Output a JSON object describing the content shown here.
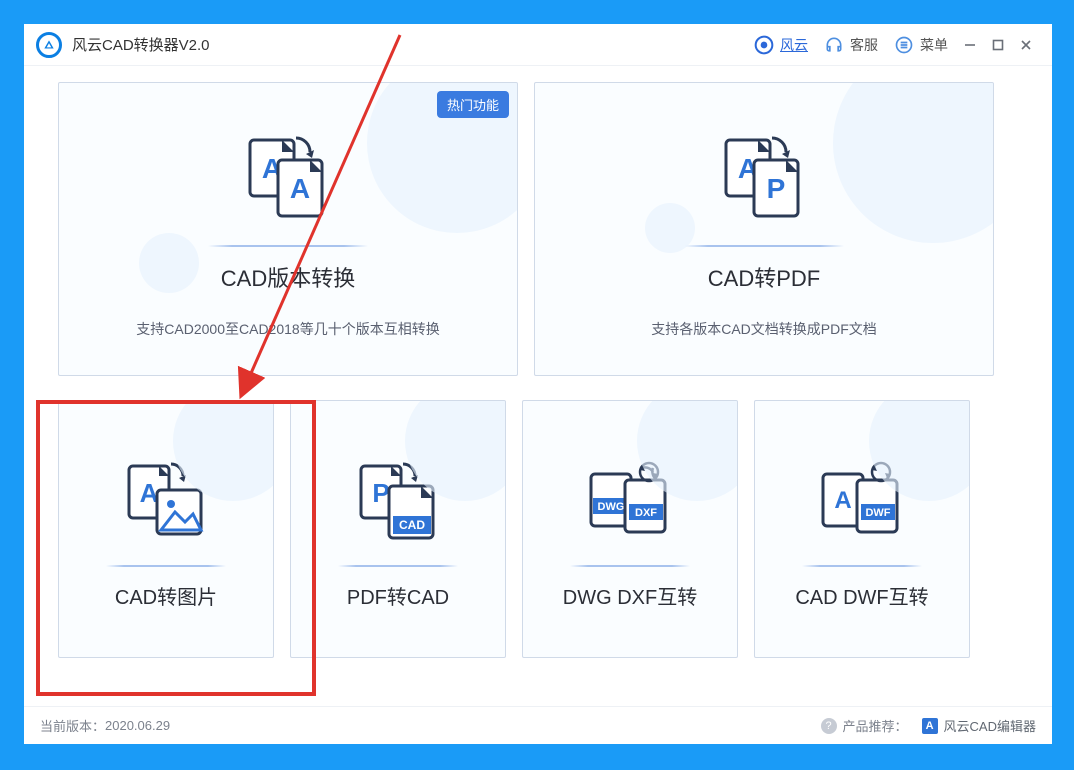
{
  "titlebar": {
    "title": "风云CAD转换器V2.0",
    "brand": "风云",
    "support": "客服",
    "menu": "菜单"
  },
  "cards": {
    "version": {
      "title": "CAD版本转换",
      "sub": "支持CAD2000至CAD2018等几十个版本互相转换",
      "badge": "热门功能"
    },
    "pdf": {
      "title": "CAD转PDF",
      "sub": "支持各版本CAD文档转换成PDF文档"
    },
    "img": {
      "title": "CAD转图片"
    },
    "pdfcad": {
      "title": "PDF转CAD"
    },
    "dwgdxf": {
      "title": "DWG DXF互转",
      "l1": "DWG",
      "l2": "DXF"
    },
    "caddwf": {
      "title": "CAD DWF互转",
      "l2": "DWF"
    }
  },
  "footer": {
    "version_label": "当前版本：",
    "version_value": "2020.06.29",
    "rec_label": "产品推荐：",
    "rec_value": "风云CAD编辑器"
  },
  "icons": {
    "letter_a": "A",
    "letter_p": "P",
    "cad": "CAD"
  }
}
